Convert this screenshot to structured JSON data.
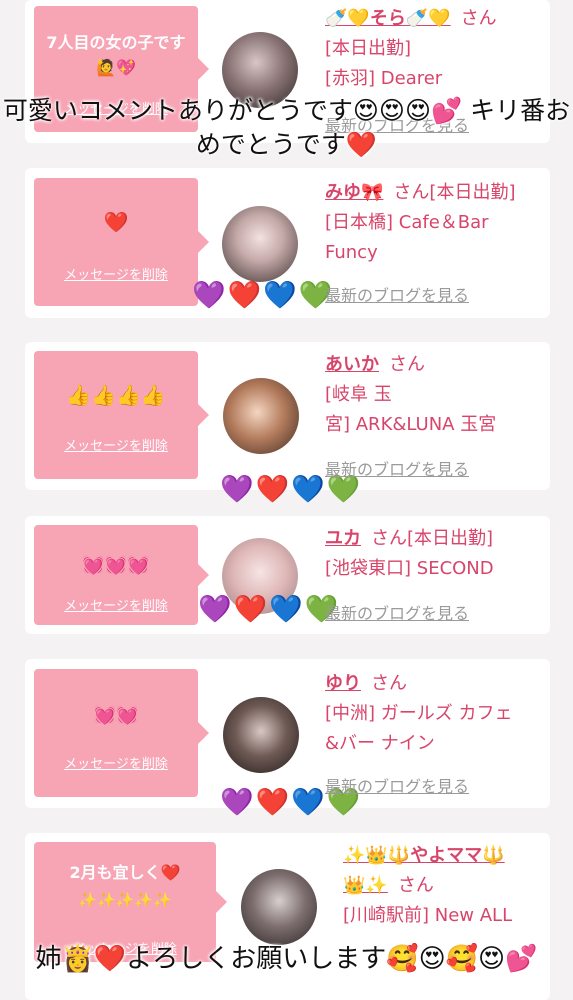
{
  "overlay": {
    "top_caption": "可愛いコメントありがとうです😍😍😍💕 キリ番おめでとうです❤️",
    "bottom_caption": "姉👸❤️よろしくお願いします🥰😍🥰😍💕"
  },
  "common": {
    "delete_label": "メッセージを削除",
    "blog_label": "最新のブログを見る",
    "san": "さん"
  },
  "cards": [
    {
      "message": "7人目の女の子です🙋💖",
      "name": "🍼💛そら🍼💛",
      "status": "",
      "shop_lines": [
        "[本日出勤]",
        "[赤羽] Dearer"
      ],
      "hearts": ""
    },
    {
      "message": "❤️",
      "name": "みゆ🎀",
      "status": "[本日出勤]",
      "shop_lines": [
        "[日本橋] Cafe＆Bar",
        "Funcy"
      ],
      "hearts": "💜❤️💙💚"
    },
    {
      "message": "👍👍👍👍",
      "name": "あいか",
      "status": "",
      "shop_lines": [
        "[岐阜 玉",
        "宮] ARK&LUNA 玉宮"
      ],
      "hearts": "💜❤️💙💚"
    },
    {
      "message": "💓💓💓",
      "name": "ユカ",
      "status": "[本日出勤]",
      "shop_lines": [
        "[池袋東口] SECOND"
      ],
      "hearts": "💜❤️💙💚"
    },
    {
      "message": "💓💓",
      "name": "ゆり",
      "status": "",
      "shop_lines": [
        "[中洲] ガールズ カフェ",
        "&バー ナイン"
      ],
      "hearts": "💜❤️💙💚"
    },
    {
      "message": "2月も宜しく❤️",
      "message2": "✨✨✨✨✨",
      "name": "✨👑🔱やよママ🔱",
      "name2": "👑✨",
      "status": "",
      "shop_lines": [
        "[川崎駅前] New ALL"
      ],
      "hearts": ""
    }
  ],
  "colors": {
    "bubble": "#f7a4b5",
    "accent": "#d8456b",
    "link": "#9a9a9a",
    "background": "#f4f2f3"
  }
}
